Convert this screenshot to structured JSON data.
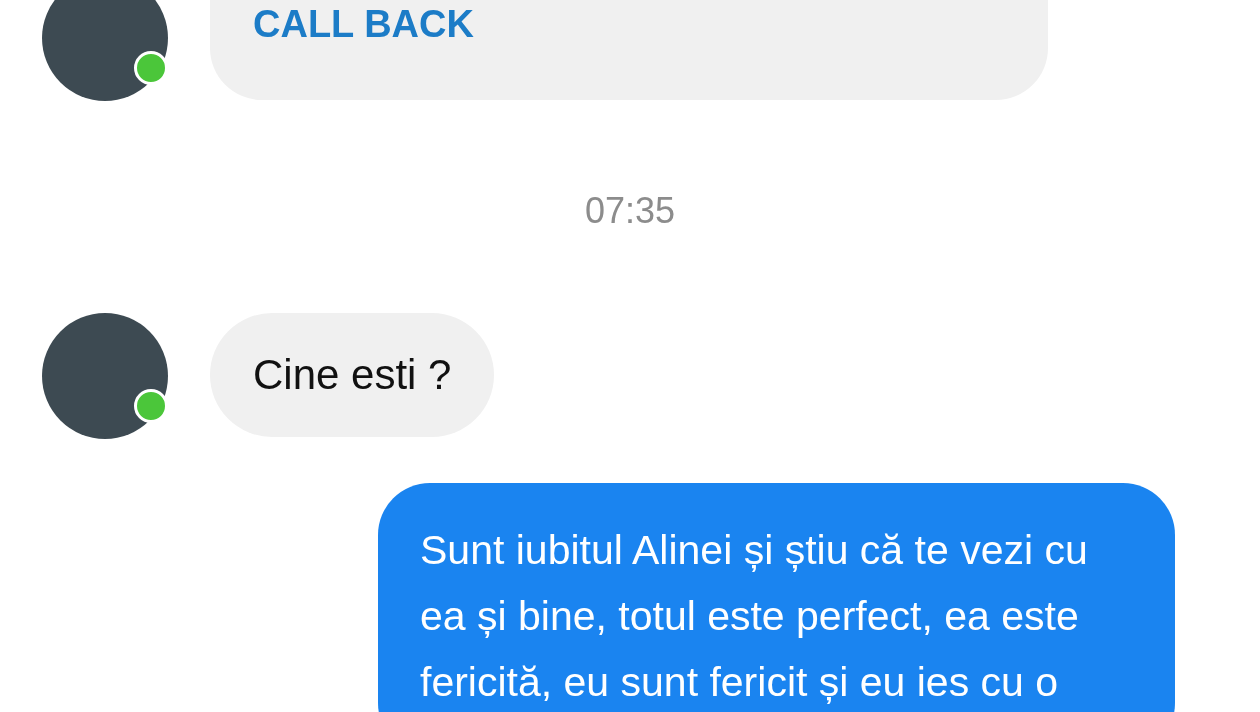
{
  "messages": [
    {
      "kind": "call",
      "outgoing": false,
      "online": true,
      "action": "CALL BACK"
    },
    {
      "kind": "time",
      "text": "07:35"
    },
    {
      "kind": "text",
      "outgoing": false,
      "online": true,
      "text": "Cine esti ?"
    },
    {
      "kind": "text",
      "outgoing": true,
      "text": "Sunt iubitul Alinei și știu că te vezi cu ea și bine, totul este perfect, ea este fericită, eu sunt fericit și eu ies cu o"
    }
  ]
}
